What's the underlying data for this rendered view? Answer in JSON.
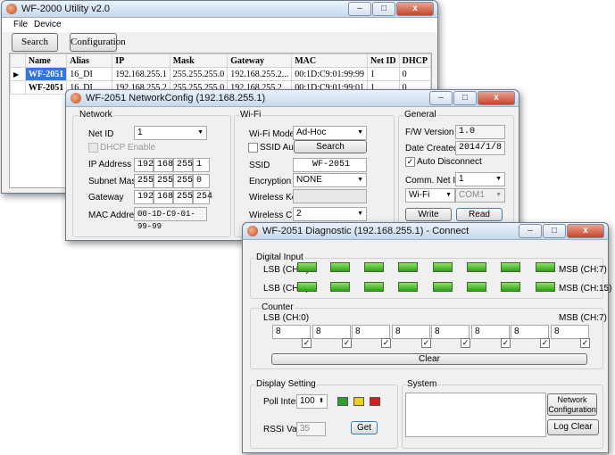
{
  "main": {
    "title": "WF-2000 Utility  v2.0",
    "menu": [
      "File",
      "Device"
    ],
    "search_label": "Search",
    "config_label": "Configuration",
    "columns": [
      "Name",
      "Alias",
      "IP",
      "Mask",
      "Gateway",
      "MAC",
      "Net ID",
      "DHCP"
    ],
    "rows": [
      [
        "WF-2051",
        "16_DI",
        "192.168.255.1",
        "255.255.255.0",
        "192.168.255.2...",
        "00:1D:C9:01:99:99",
        "1",
        "0"
      ],
      [
        "WF-2051",
        "16_DI",
        "192.168.255.2",
        "255.255.255.0",
        "192.168.255.2...",
        "00:1D:C9:01:99:01",
        "1",
        "0"
      ]
    ],
    "selected_marker": "▶"
  },
  "netconfig": {
    "title": "WF-2051 NetworkConfig (192.168.255.1)",
    "network": {
      "group": "Network",
      "netid_label": "Net ID",
      "netid_value": "1",
      "dhcp_label": "DHCP Enable",
      "ip_label": "IP Address",
      "ip": [
        "192",
        "168",
        "255",
        "1"
      ],
      "mask_label": "Subnet Mask",
      "mask": [
        "255",
        "255",
        "255",
        "0"
      ],
      "gw_label": "Gateway",
      "gw": [
        "192",
        "168",
        "255",
        "254"
      ],
      "mac_label": "MAC Address",
      "mac_value": "00-1D-C9-01-99-99"
    },
    "wifi": {
      "group": "Wi-Fi",
      "modes_label": "Wi-Fi Modes",
      "modes_value": "Ad-Hoc",
      "ssid_auto_label": "SSID Auto Search",
      "search_label": "Search",
      "ssid_label": "SSID",
      "ssid_value": "WF-2051",
      "enc_label": "Encryption",
      "enc_value": "NONE",
      "key_label": "Wireless Key",
      "ch_label": "Wireless CH",
      "ch_value": "2"
    },
    "general": {
      "group": "General",
      "fw_label": "F/W Version",
      "fw_value": "1.0",
      "date_label": "Date Created",
      "date_value": "2014/1/8",
      "auto_disc_label": "Auto Disconnect",
      "comm_label": "Comm. Net ID",
      "comm_value": "1",
      "iface_value": "Wi-Fi",
      "port_value": "COM1",
      "write_label": "Write",
      "read_label": "Read"
    }
  },
  "diag": {
    "title": "WF-2051 Diagnostic (192.168.255.1) - Connect",
    "di_group": "Digital Input",
    "lsb0": "LSB (CH:0)",
    "msb7": "MSB (CH:7)",
    "lsb8": "LSB (CH:8)",
    "msb15": "MSB (CH:15)",
    "counter_group": "Counter",
    "c_lsb": "LSB (CH:0)",
    "c_msb": "MSB (CH:7)",
    "counters": [
      "8",
      "8",
      "8",
      "8",
      "8",
      "8",
      "8",
      "8"
    ],
    "clear_label": "Clear",
    "display_group": "Display Setting",
    "poll_label": "Poll Interval",
    "poll_value": "100",
    "rssi_label": "RSSI Value",
    "rssi_value": "35",
    "get_label": "Get",
    "system_group": "System",
    "netcfg_label": "Network Configuration",
    "logclear_label": "Log Clear",
    "indicator_colors": [
      "#2ea02e",
      "#e6d21a",
      "#d21e1e"
    ]
  }
}
